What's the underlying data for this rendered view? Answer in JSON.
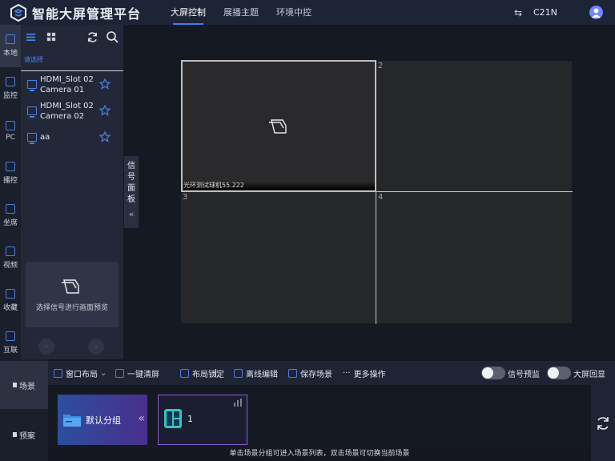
{
  "header": {
    "title": "智能大屏管理平台",
    "nav": [
      "大屏控制",
      "展播主题",
      "环境中控"
    ],
    "active_nav": 0,
    "user": "C21N"
  },
  "leftnav": {
    "items": [
      "本地",
      "监控",
      "PC",
      "播控",
      "坐席",
      "视频",
      "收藏",
      "互联"
    ],
    "active": 0
  },
  "signal_panel": {
    "sub_label": "请选择",
    "items": [
      {
        "name": "HDMI_Slot 02 Camera 01"
      },
      {
        "name": "HDMI_Slot 02 Camera 02"
      },
      {
        "name": "aa"
      }
    ],
    "preview_text": "选择信号进行画面预览",
    "collapse_label": [
      "信",
      "号",
      "面",
      "板"
    ]
  },
  "wall": {
    "window1_label": "光环测试球机55.222",
    "cells": [
      "2",
      "3",
      "4"
    ]
  },
  "scene_side": {
    "items": [
      "场景",
      "预案"
    ],
    "active": 0
  },
  "toolbar": {
    "window_layout": "窗口布局",
    "clear": "一键清屏",
    "separator": "|",
    "lock": "布局锁定",
    "offline_edit": "离线编辑",
    "save_scene": "保存场景",
    "more": "更多操作",
    "signal_preview": "信号预监",
    "wall_echo": "大屏回显"
  },
  "scenes": {
    "group_label": "默认分组",
    "scene_name": "1",
    "hint": "单击场景分组可进入场景列表，双击场景可切换当前场景"
  },
  "colors": {
    "accent": "#3d7bfa",
    "header_bg": "#1d2436",
    "panel_bg": "#232838"
  }
}
